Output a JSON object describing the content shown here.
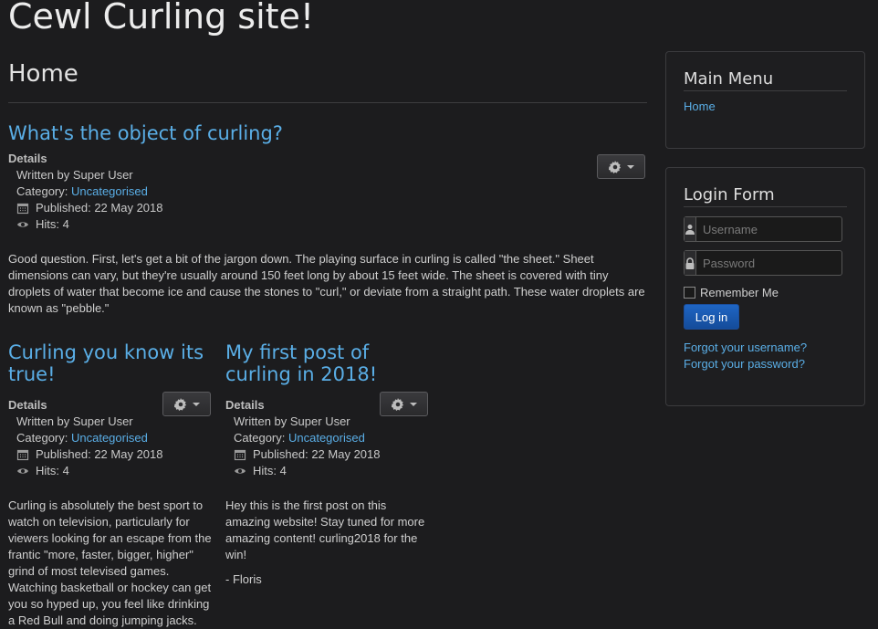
{
  "site": {
    "title": "Cewl Curling site!"
  },
  "page": {
    "heading": "Home"
  },
  "articles": [
    {
      "title": "What's the object of curling?",
      "details_label": "Details",
      "written_by": "Written by Super User",
      "category_prefix": "Category: ",
      "category": "Uncategorised",
      "published": "Published: 22 May 2018",
      "hits": "Hits: 4",
      "body": "Good question. First, let's get a bit of the jargon down. The playing surface in curling is called \"the sheet.\" Sheet dimensions can vary, but they're usually around 150 feet long by about 15 feet wide. The sheet is covered with tiny droplets of water that become ice and cause the stones to \"curl,\" or deviate from a straight path. These water droplets are known as \"pebble.\""
    },
    {
      "title": "Curling you know its true!",
      "details_label": "Details",
      "written_by": "Written by Super User",
      "category_prefix": "Category: ",
      "category": "Uncategorised",
      "published": "Published: 22 May 2018",
      "hits": "Hits: 4",
      "body": "Curling is absolutely the best sport to watch on television, particularly for viewers looking for an escape from the frantic \"more, faster, bigger, higher\" grind of most televised games. Watching basketball or hockey can get you so hyped up, you feel like drinking a Red Bull and doing jumping jacks."
    },
    {
      "title": "My first post of curling in 2018!",
      "details_label": "Details",
      "written_by": "Written by Super User",
      "category_prefix": "Category: ",
      "category": "Uncategorised",
      "published": "Published: 22 May 2018",
      "hits": "Hits: 4",
      "body": "Hey this is the first post on this amazing website! Stay tuned for more amazing content! curling2018 for the win!",
      "signature": "- Floris"
    }
  ],
  "sidebar": {
    "main_menu": {
      "title": "Main Menu",
      "items": [
        "Home"
      ]
    },
    "login_form": {
      "title": "Login Form",
      "username_placeholder": "Username",
      "password_placeholder": "Password",
      "remember_label": "Remember Me",
      "login_button": "Log in",
      "forgot_username": "Forgot your username?",
      "forgot_password": "Forgot your password?"
    }
  },
  "colors": {
    "background": "#1c1c1e",
    "link": "#5aaee6",
    "primary_button": "#1f66c4"
  },
  "icons": [
    "gear-icon",
    "caret-down-icon",
    "calendar-icon",
    "eye-icon",
    "user-icon",
    "lock-icon"
  ]
}
